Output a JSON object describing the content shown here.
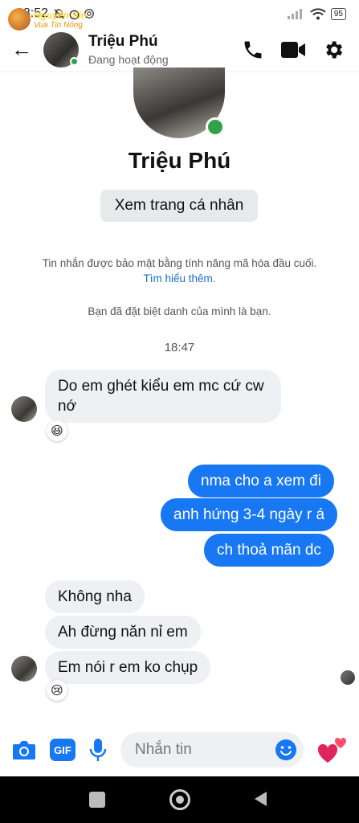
{
  "statusbar": {
    "time": "18:52",
    "battery": "95"
  },
  "header": {
    "back_icon": "←",
    "name": "Triệu Phú",
    "status": "Đang hoạt động"
  },
  "profile": {
    "name": "Triệu Phú",
    "view_profile_button": "Xem trang cá nhân",
    "encryption_text": "Tin nhắn được bảo mật bằng tính năng mã hóa đầu cuối.",
    "learn_more_link": "Tìm hiểu thêm.",
    "nickname_notice": "Bạn đã đặt biệt danh của mình là bạn."
  },
  "timestamp": "18:47",
  "messages": [
    {
      "from": "them",
      "text": "Do em ghét kiểu em mc cứ cw nớ",
      "reaction": "😆"
    },
    {
      "from": "me",
      "text": "nma cho a xem đi"
    },
    {
      "from": "me",
      "text": "anh hứng 3-4 ngày r á"
    },
    {
      "from": "me",
      "text": "ch thoả mãn dc"
    },
    {
      "from": "them",
      "text": "Không nha"
    },
    {
      "from": "them",
      "text": "Ah đừng năn nỉ em"
    },
    {
      "from": "them",
      "text": "Em nói r em ko chụp",
      "reaction": "😢"
    }
  ],
  "composer": {
    "gif_label": "GIF",
    "placeholder": "Nhắn tin"
  },
  "watermark": {
    "line1": "Nguyễn Sin",
    "line2": "Vua Tin Nóng"
  },
  "colors": {
    "accent": "#1877f2",
    "online": "#31a24c",
    "incoming_bg": "#eff0f3"
  }
}
